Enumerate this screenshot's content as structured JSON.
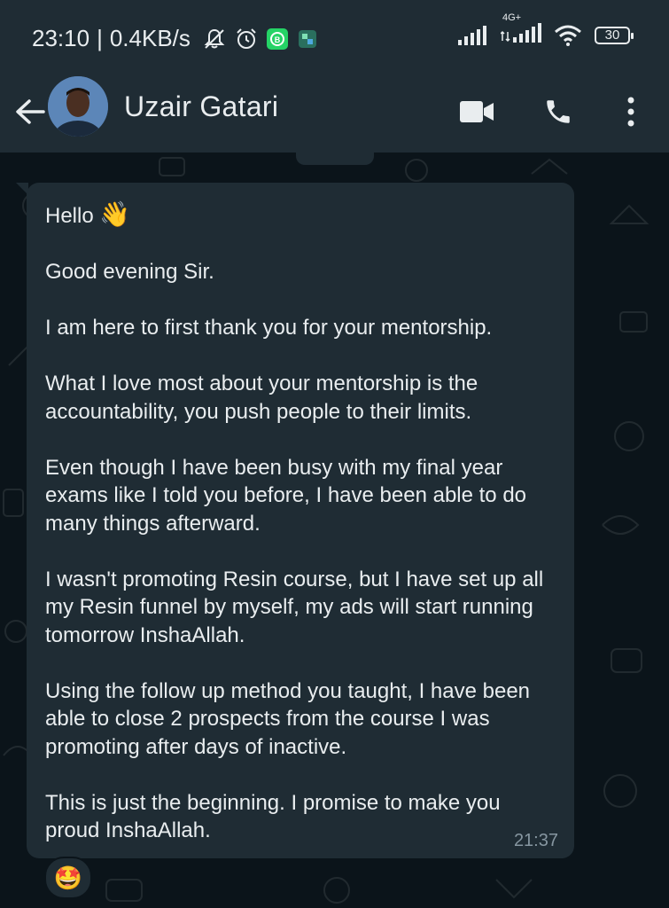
{
  "status_bar": {
    "time": "23:10",
    "speed": "0.4KB/s",
    "network_label": "4G+",
    "battery": "30"
  },
  "header": {
    "contact_name": "Uzair Gatari"
  },
  "message": {
    "greeting": "Hello",
    "greeting_emoji": "👋",
    "paragraphs": [
      "Good evening Sir.",
      "I am here to first thank you for your mentorship.",
      "What I love most about your mentorship is the accountability, you push people to their limits.",
      "Even though I have been busy with my final year exams like I told you before, I have been able to do many things afterward.",
      "I wasn't promoting Resin course, but I have set up all my Resin funnel by myself, my ads will start running tomorrow InshaAllah.",
      "Using the follow up method you taught, I have been able to close 2 prospects from the course I was promoting after days of inactive.",
      "This is just the beginning. I promise to make you proud InshaAllah."
    ],
    "time": "21:37",
    "reaction": "🤩"
  },
  "colors": {
    "header_bg": "#1f2c34",
    "chat_bg": "#0b141a",
    "bubble_bg": "#1f2c34",
    "text": "#e9edef",
    "meta_text": "#8696a0"
  },
  "icons": {
    "back": "arrow-left-icon",
    "video": "video-call-icon",
    "phone": "phone-icon",
    "menu": "more-vertical-icon",
    "mute": "bell-off-icon",
    "alarm": "alarm-icon",
    "wifi": "wifi-icon",
    "signal": "signal-icon"
  }
}
